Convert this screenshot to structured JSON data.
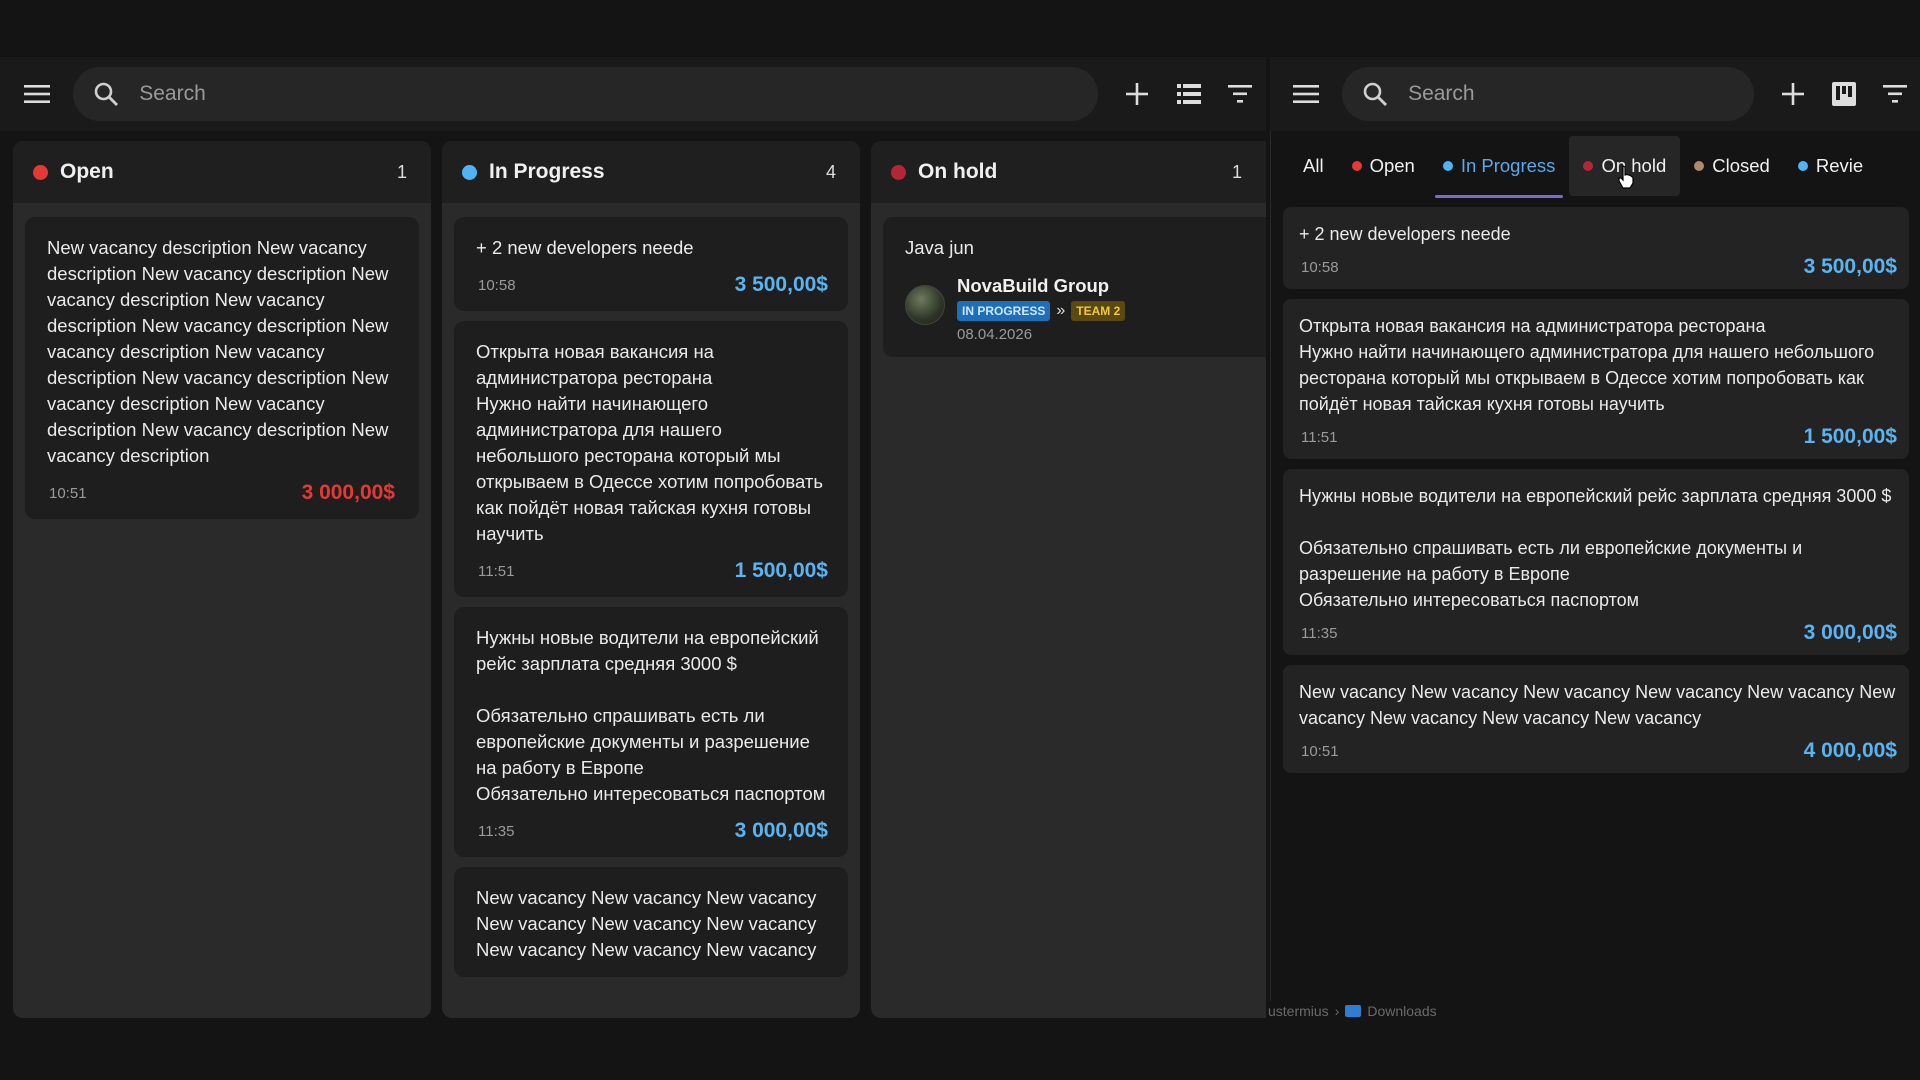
{
  "left": {
    "search_placeholder": "Search",
    "columns": [
      {
        "title": "Open",
        "count": "1",
        "color": "#e53935",
        "cards": [
          {
            "text": "New vacancy description New vacancy description New vacancy description New vacancy description New vacancy description New vacancy description New vacancy description New vacancy description New vacancy description New vacancy description New vacancy description New vacancy description New vacancy description",
            "time": "10:51",
            "amount": "3 000,00$",
            "amount_color": "#e53935"
          }
        ]
      },
      {
        "title": "In Progress",
        "count": "4",
        "color": "#4fb3f6",
        "cards": [
          {
            "text": "+ 2 new developers neede",
            "time": "10:58",
            "amount": "3 500,00$",
            "amount_color": "#5ab4f0"
          },
          {
            "text": "Открыта новая вакансия на администратора ресторана\nНужно найти начинающего администратора для нашего небольшого ресторана который мы открываем в Одессе хотим попробовать как пойдёт новая тайская кухня готовы научить",
            "time": "11:51",
            "amount": "1 500,00$",
            "amount_color": "#5ab4f0"
          },
          {
            "text": "Нужны новые водители на европейский рейс зарплата средняя 3000 $\n\nОбязательно спрашивать есть ли европейские документы и разрешение на работу в Европе\nОбязательно интересоваться паспортом",
            "time": "11:35",
            "amount": "3 000,00$",
            "amount_color": "#5ab4f0"
          },
          {
            "text": "New vacancy New vacancy New vacancy New vacancy New vacancy New vacancy New vacancy New vacancy New vacancy"
          }
        ]
      },
      {
        "title": "On hold",
        "count": "1",
        "color": "#b3263a",
        "card": {
          "title": "Java jun",
          "company": "NovaBuild Group",
          "badge_status": "IN PROGRESS",
          "badge_arrow": "»",
          "badge_team": "TEAM 2",
          "date": "08.04.2026"
        }
      }
    ]
  },
  "right": {
    "search_placeholder": "Search",
    "tabs": [
      {
        "label": "All"
      },
      {
        "label": "Open",
        "color": "#e53935"
      },
      {
        "label": "In Progress",
        "color": "#4fb3f6",
        "active": true
      },
      {
        "label": "On hold",
        "color": "#b3263a"
      },
      {
        "label": "Closed",
        "color": "#b08a6e"
      },
      {
        "label": "Revie",
        "color": "#4fb3f6"
      }
    ],
    "cards": [
      {
        "text": "+ 2 new developers neede",
        "time": "10:58",
        "amount": "3 500,00$"
      },
      {
        "text": "Открыта новая вакансия на администратора ресторана\nНужно найти начинающего администратора для нашего небольшого ресторана который мы открываем в Одессе хотим попробовать как пойдёт новая тайская кухня готовы научить",
        "time": "11:51",
        "amount": "1 500,00$"
      },
      {
        "text": "Нужны новые водители на европейский рейс зарплата средняя 3000 $\n\nОбязательно спрашивать есть ли европейские документы и разрешение на работу в Европе\nОбязательно интересоваться паспортом",
        "time": "11:35",
        "amount": "3 000,00$"
      },
      {
        "text": "New vacancy New vacancy New vacancy New vacancy New vacancy New vacancy New vacancy New vacancy New vacancy",
        "time": "10:51",
        "amount": "4 000,00$"
      }
    ],
    "amount_color": "#5ab4f0"
  },
  "path": {
    "segment1": "ustermius",
    "separator": "›",
    "segment2": "Downloads"
  }
}
